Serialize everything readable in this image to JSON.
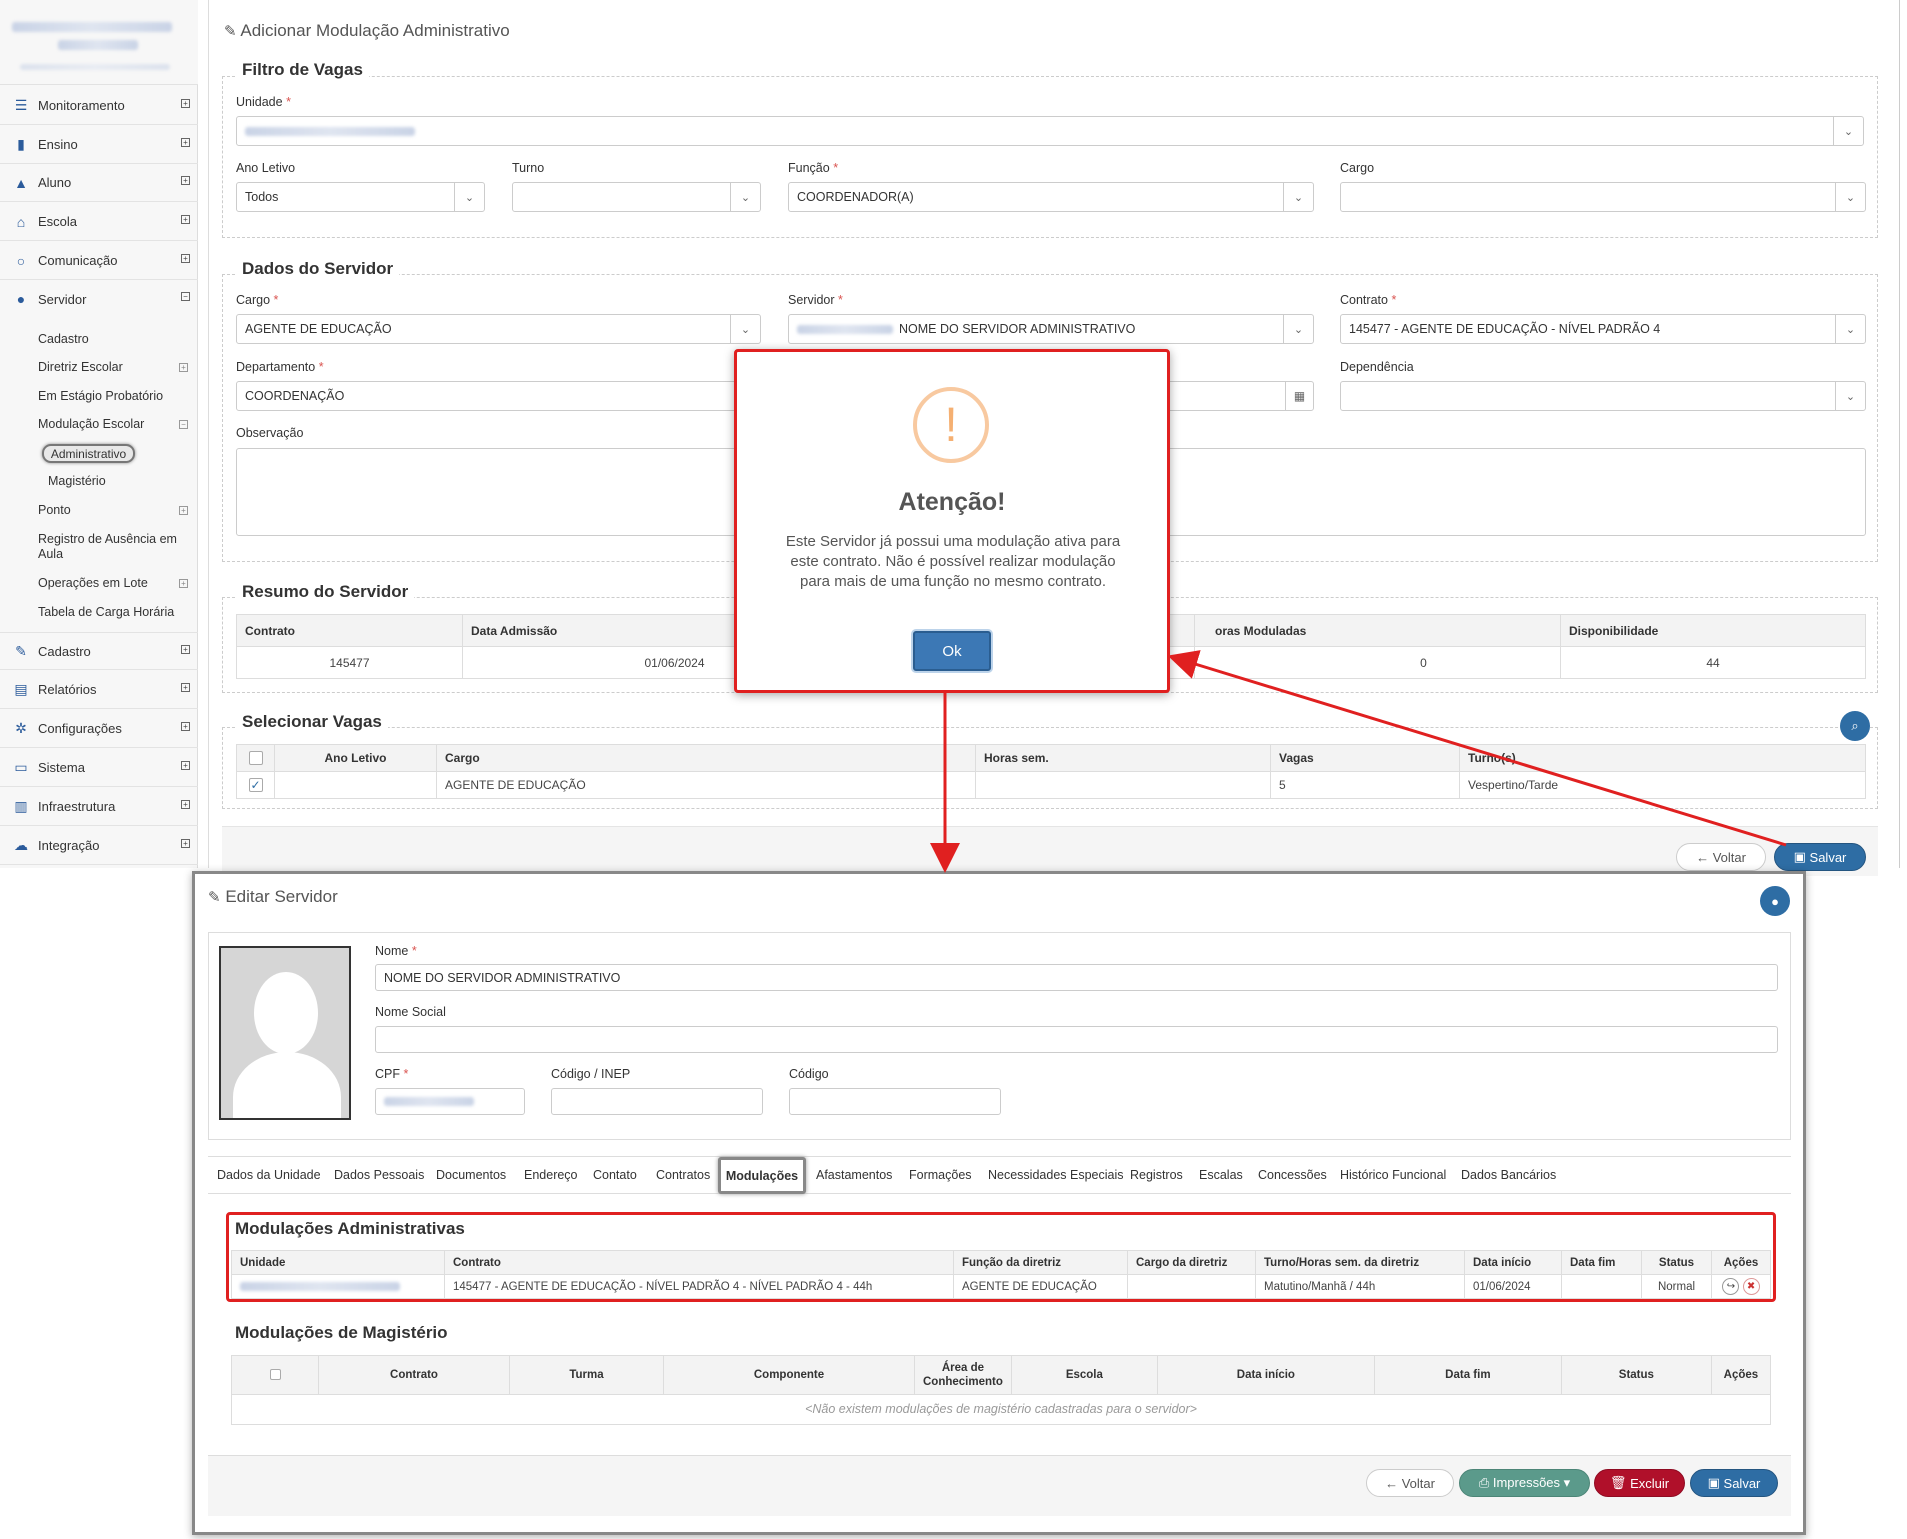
{
  "sidebar": {
    "items": [
      {
        "label": "Monitoramento",
        "icon": "sliders-icon"
      },
      {
        "label": "Ensino",
        "icon": "book-icon"
      },
      {
        "label": "Aluno",
        "icon": "graduation-cap-icon"
      },
      {
        "label": "Escola",
        "icon": "bank-icon"
      },
      {
        "label": "Comunicação",
        "icon": "chat-icon"
      },
      {
        "label": "Servidor",
        "icon": "user-icon"
      }
    ],
    "servidor_subitems": [
      "Cadastro",
      "Diretriz Escolar",
      "Em Estágio Probatório",
      "Modulação Escolar"
    ],
    "modulacao_subitems": [
      "Administrativo",
      "Magistério"
    ],
    "servidor_more": [
      "Ponto",
      "Registro de Ausência em Aula",
      "Operações em Lote",
      "Tabela de Carga Horária"
    ],
    "bottom_items": [
      {
        "label": "Cadastro",
        "icon": "edit-icon"
      },
      {
        "label": "Relatórios",
        "icon": "file-icon"
      },
      {
        "label": "Configurações",
        "icon": "gear-icon"
      },
      {
        "label": "Sistema",
        "icon": "monitor-icon"
      },
      {
        "label": "Infraestrutura",
        "icon": "building-icon"
      },
      {
        "label": "Integração",
        "icon": "cloud-icon"
      }
    ]
  },
  "top": {
    "title": "Adicionar Modulação Administrativo",
    "filtro": {
      "legend": "Filtro de Vagas",
      "unidade_label": "Unidade",
      "ano_label": "Ano Letivo",
      "ano_value": "Todos",
      "turno_label": "Turno",
      "turno_value": "",
      "funcao_label": "Função",
      "funcao_value": "COORDENADOR(A)",
      "cargo_label": "Cargo",
      "cargo_value": ""
    },
    "dados": {
      "legend": "Dados do Servidor",
      "cargo_label": "Cargo",
      "cargo_value": "AGENTE DE EDUCAÇÃO",
      "servidor_label": "Servidor",
      "servidor_value": "NOME DO SERVIDOR ADMINISTRATIVO",
      "contrato_label": "Contrato",
      "contrato_value": "145477 - AGENTE DE EDUCAÇÃO - NÍVEL PADRÃO 4",
      "departamento_label": "Departamento",
      "departamento_value": "COORDENAÇÃO",
      "dependencia_label": "Dependência",
      "dependencia_value": "",
      "observacao_label": "Observação"
    },
    "resumo": {
      "legend": "Resumo do Servidor",
      "headers": [
        "Contrato",
        "Data Admissão",
        "oras Moduladas",
        "Disponibilidade"
      ],
      "values": [
        "145477",
        "01/06/2024",
        "0",
        "44"
      ]
    },
    "vagas": {
      "legend": "Selecionar Vagas",
      "headers": [
        "Ano Letivo",
        "Cargo",
        "Horas sem.",
        "Vagas",
        "Turno(s)"
      ],
      "row": [
        "",
        "AGENTE DE EDUCAÇÃO",
        "",
        "5",
        "Vespertino/Tarde"
      ]
    },
    "buttons": {
      "voltar": "Voltar",
      "salvar": "Salvar"
    }
  },
  "modal": {
    "title": "Atenção!",
    "message": "Este Servidor já possui uma modulação ativa para este contrato. Não é possível realizar modulação para mais de uma função no mesmo contrato.",
    "ok": "Ok",
    "icon": "!"
  },
  "bottom": {
    "title": "Editar Servidor",
    "nome_label": "Nome",
    "nome_value": "NOME DO SERVIDOR ADMINISTRATIVO",
    "nome_social_label": "Nome Social",
    "cpf_label": "CPF",
    "inep_label": "Código / INEP",
    "codigo_label": "Código",
    "tabs": [
      "Dados da Unidade",
      "Dados Pessoais",
      "Documentos",
      "Endereço",
      "Contato",
      "Contratos",
      "Modulações",
      "Afastamentos",
      "Formações",
      "Necessidades Especiais",
      "Registros",
      "Escalas",
      "Concessões",
      "Histórico Funcional",
      "Dados Bancários"
    ],
    "adm": {
      "legend": "Modulações Administrativas",
      "headers": [
        "Unidade",
        "Contrato",
        "Função da diretriz",
        "Cargo da diretriz",
        "Turno/Horas sem. da diretriz",
        "Data início",
        "Data fim",
        "Status",
        "Ações"
      ],
      "row": [
        "",
        "145477 - AGENTE DE EDUCAÇÃO - NÍVEL PADRÃO 4 - NÍVEL PADRÃO 4 - 44h",
        "AGENTE DE EDUCAÇÃO",
        "",
        "Matutino/Manhã / 44h",
        "01/06/2024",
        "",
        "Normal"
      ]
    },
    "mag": {
      "legend": "Modulações de Magistério",
      "headers": [
        "Contrato",
        "Turma",
        "Componente",
        "Área de Conhecimento",
        "Escola",
        "Data início",
        "Data fim",
        "Status",
        "Ações"
      ],
      "empty": "<Não existem modulações de magistério cadastradas para o servidor>"
    },
    "buttons": {
      "voltar": "Voltar",
      "impressoes": "Impressões ▾",
      "excluir": "Excluir",
      "salvar": "Salvar"
    }
  },
  "colors": {
    "primary": "#2e6da4",
    "danger": "#b0102a",
    "success": "#5b9a8b",
    "highlight": "#e02020"
  }
}
